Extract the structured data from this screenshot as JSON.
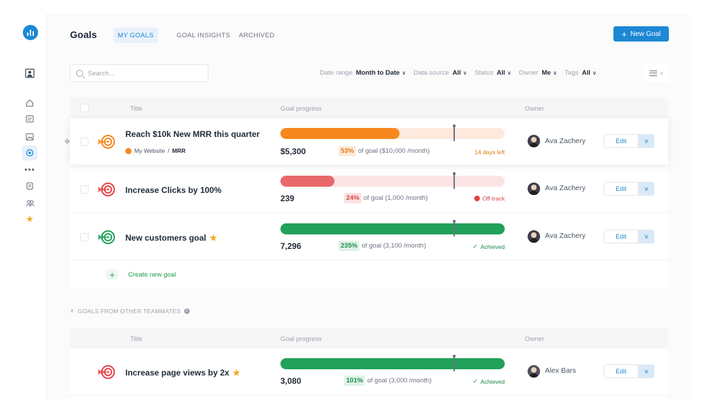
{
  "header": {
    "title": "Goals",
    "tabs": [
      {
        "label": "MY GOALS",
        "active": true
      },
      {
        "label": "GOAL INSIGHTS",
        "active": false
      },
      {
        "label": "ARCHIVED",
        "active": false
      }
    ],
    "new_goal_label": "New Goal",
    "new_goal_icon": "plus-icon"
  },
  "toolbar": {
    "search_placeholder": "Search...",
    "filters": [
      {
        "label": "Date range",
        "value": "Month to Date"
      },
      {
        "label": "Data source",
        "value": "All"
      },
      {
        "label": "Status",
        "value": "All"
      },
      {
        "label": "Owner",
        "value": "Me"
      },
      {
        "label": "Tags",
        "value": "All"
      }
    ]
  },
  "sidebar": {
    "icons": [
      "dashboard-logo",
      "account-icon",
      "home-icon",
      "reports-icon",
      "gallery-icon",
      "goals-icon",
      "more-icon",
      "data-icon",
      "team-icon",
      "favorites-icon"
    ]
  },
  "my_goals": {
    "columns": {
      "title": "Title",
      "progress": "Goal progress",
      "owner": "Owner"
    },
    "rows": [
      {
        "title": "Reach $10k New MRR this quarter",
        "starred": false,
        "source_name": "My Website",
        "source_metric": "MRR",
        "current": "$5,300",
        "percent": "53%",
        "goal_text": "of goal ($10,000 /month)",
        "status": "14 days left",
        "owner": "Ava Zachery",
        "progress": 0.53,
        "color": "#f7881e",
        "track": "#fde9dd"
      },
      {
        "title": "Increase Clicks by 100%",
        "starred": false,
        "current": "239",
        "percent": "24%",
        "goal_text": "of goal (1,000 /month)",
        "status": "Off-track",
        "owner": "Ava Zachery",
        "progress": 0.24,
        "color": "#e8696b",
        "track": "#fbe4e4"
      },
      {
        "title": "New customers goal",
        "starred": true,
        "current": "7,296",
        "percent": "235%",
        "goal_text": "of goal (3,100 /month)",
        "status": "Achieved",
        "owner": "Ava Zachery",
        "progress": 1.0,
        "color": "#21a15a",
        "track": "#e6f5ec"
      }
    ],
    "edit_label": "Edit",
    "create_label": "Create new goal"
  },
  "teammates": {
    "section_label": "GOALS FROM OTHER TEAMMATES",
    "columns": {
      "title": "Title",
      "progress": "Goal progress",
      "owner": "Owner"
    },
    "rows": [
      {
        "title": "Increase page views by 2x",
        "starred": true,
        "current": "3,080",
        "percent": "101%",
        "goal_text": "of goal (3,000 /month)",
        "status": "Achieved",
        "owner": "Alex Bars",
        "progress": 1.0,
        "color": "#21a15a",
        "track": "#e6f5ec"
      }
    ],
    "edit_label": "Edit"
  },
  "colors": {
    "accent": "#1c88d4",
    "orange": "#f7881e",
    "red": "#e8696b",
    "green": "#21a15a"
  }
}
